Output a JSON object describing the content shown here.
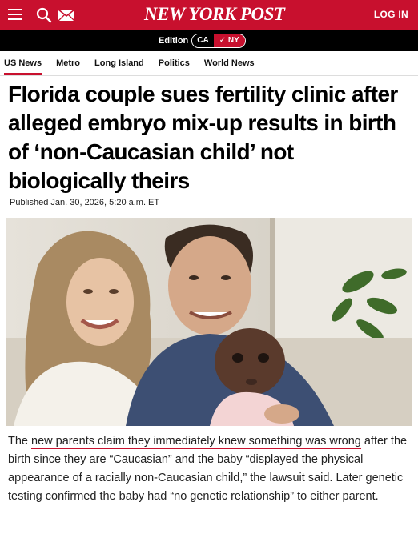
{
  "header": {
    "logo": "NEW YORK POST",
    "login_label": "LOG IN",
    "icons": [
      "menu-icon",
      "search-icon",
      "mail-icon"
    ],
    "brand_color": "#c8102e"
  },
  "edition": {
    "label": "Edition",
    "options": [
      "CA",
      "NY"
    ],
    "selected": "NY"
  },
  "nav": {
    "items": [
      "US News",
      "Metro",
      "Long Island",
      "Politics",
      "World News"
    ],
    "active": "US News"
  },
  "article": {
    "headline": "Florida couple sues fertility clinic after alleged embryo mix-up results in birth of ‘non-Caucasian child’ not biologically theirs",
    "published": "Published Jan. 30, 2026, 5:20 a.m. ET",
    "caption_before": "The ",
    "caption_highlight": "new parents claim they immediately knew something was wrong",
    "caption_after": " after the birth since they are “Caucasian” and the baby “displayed the physical appearance of a racially non-Caucasian child,” the lawsuit said. Later genetic testing confirmed the baby had “no genetic relationship” to either parent."
  }
}
